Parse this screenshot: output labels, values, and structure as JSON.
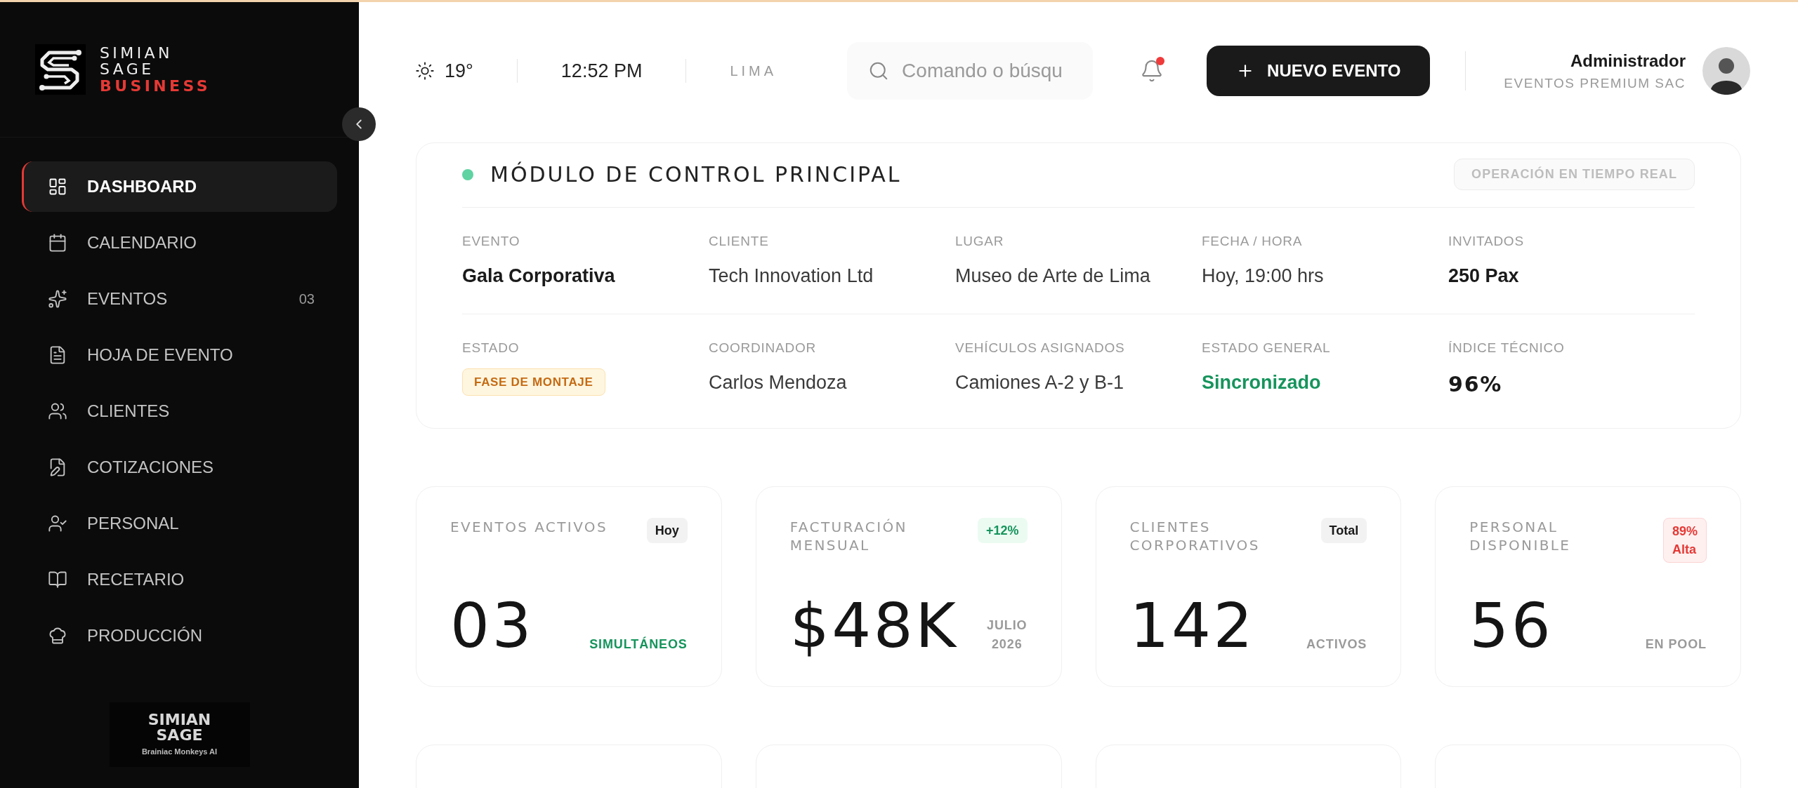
{
  "sidebar": {
    "logo": {
      "line_1": "SIMIAN",
      "line_2": "SAGE",
      "line_3": "BUSINESS"
    },
    "items": [
      {
        "label": "DASHBOARD",
        "selected": true
      },
      {
        "label": "CALENDARIO",
        "selected": false
      },
      {
        "label": "EVENTOS",
        "selected": false,
        "count": "03"
      },
      {
        "label": "HOJA DE EVENTO",
        "selected": false
      },
      {
        "label": "CLIENTES",
        "selected": false
      },
      {
        "label": "COTIZACIONES",
        "selected": false
      },
      {
        "label": "PERSONAL",
        "selected": false
      },
      {
        "label": "RECETARIO",
        "selected": false
      },
      {
        "label": "PRODUCCIÓN",
        "selected": false
      }
    ],
    "footer_logo": {
      "line_1": "SIMIAN",
      "line_2": "SAGE",
      "tagline": "Brainiac Monkeys AI"
    }
  },
  "header": {
    "temperature": "19°",
    "time": "12:52 PM",
    "city": "LIMA",
    "search": {
      "placeholder": "Comando o búsqu"
    },
    "notifications": {
      "unread": true
    },
    "new_event_button": "NUEVO EVENTO",
    "user": {
      "name": "Administrador",
      "company": "EVENTOS PREMIUM SAC"
    }
  },
  "module": {
    "title": "MÓDULO DE CONTROL PRINCIPAL",
    "live": true,
    "badge": "OPERACIÓN EN TIEMPO REAL",
    "rows": [
      [
        {
          "label": "EVENTO",
          "value": "Gala Corporativa",
          "kind": "emphasis"
        },
        {
          "label": "CLIENTE",
          "value": "Tech Innovation Ltd",
          "kind": "plain"
        },
        {
          "label": "LUGAR",
          "value": "Museo de Arte de Lima",
          "kind": "plain"
        },
        {
          "label": "FECHA / HORA",
          "value": "Hoy, 19:00 hrs",
          "kind": "plain"
        },
        {
          "label": "INVITADOS",
          "value": "250 Pax",
          "kind": "emphasis"
        }
      ],
      [
        {
          "label": "ESTADO",
          "value": "FASE DE MONTAJE",
          "kind": "badge"
        },
        {
          "label": "COORDINADOR",
          "value": "Carlos Mendoza",
          "kind": "plain"
        },
        {
          "label": "VEHÍCULOS ASIGNADOS",
          "value": "Camiones A-2 y B-1",
          "kind": "plain"
        },
        {
          "label": "ESTADO GENERAL",
          "value": "Sincronizado",
          "kind": "success"
        },
        {
          "label": "ÍNDICE TÉCNICO",
          "value": "96%",
          "kind": "metric"
        }
      ]
    ]
  },
  "stats": [
    {
      "title": "EVENTOS ACTIVOS",
      "tag": {
        "text": "Hoy",
        "kind": "neutral"
      },
      "value": "03",
      "note": {
        "lines": [
          "SIMULTÁNEOS"
        ],
        "kind": "success"
      }
    },
    {
      "title": "FACTURACIÓN MENSUAL",
      "tag": {
        "text": "+12%",
        "kind": "success"
      },
      "value": "$48K",
      "note": {
        "lines": [
          "JULIO",
          "2026"
        ],
        "kind": "muted"
      }
    },
    {
      "title": "CLIENTES CORPORATIVOS",
      "tag": {
        "text": "Total",
        "kind": "neutral"
      },
      "value": "142",
      "note": {
        "lines": [
          "ACTIVOS"
        ],
        "kind": "muted"
      }
    },
    {
      "title": "PERSONAL DISPONIBLE",
      "tag": {
        "text": "89% Alta",
        "kind": "danger"
      },
      "value": "56",
      "note": {
        "lines": [
          "EN POOL"
        ],
        "kind": "muted"
      }
    }
  ]
}
